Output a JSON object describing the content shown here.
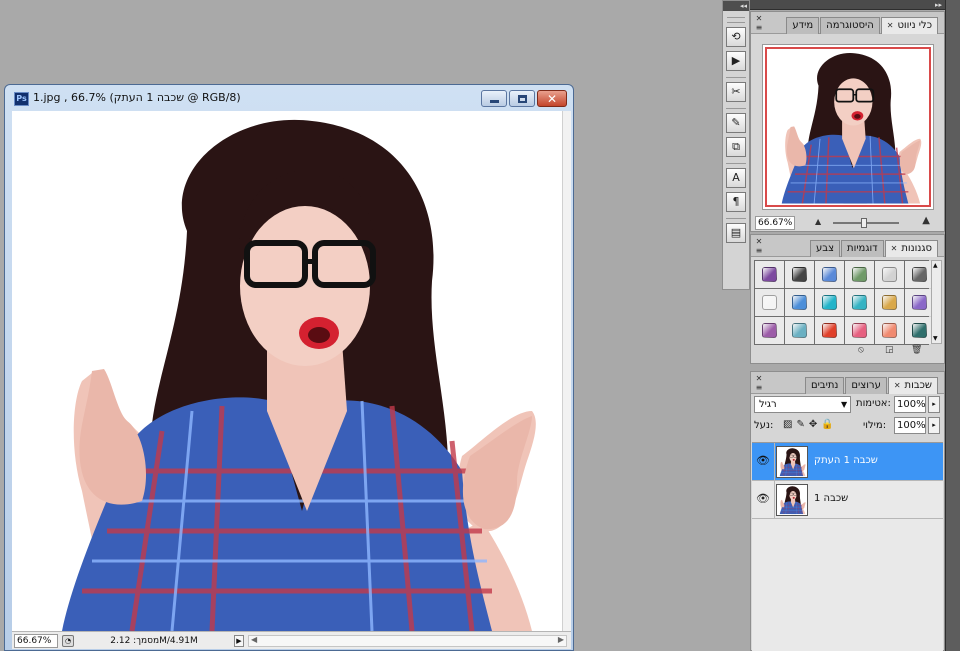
{
  "document": {
    "title": "1.jpg , שכבה 1 העתק) 66.7% @ RGB/8)",
    "app_badge": "Ps",
    "status": {
      "zoom": "66.67%",
      "size": "מסמך: 2.12M/4.91M"
    }
  },
  "tools": {
    "items": [
      {
        "icon": "history-brush-icon",
        "glyph": "⟲"
      },
      {
        "icon": "play-action-icon",
        "glyph": "▶"
      },
      {
        "icon": "tool-presets-icon",
        "glyph": "✂"
      },
      {
        "icon": "brushes-icon",
        "glyph": "✎"
      },
      {
        "icon": "clone-source-icon",
        "glyph": "⧉"
      },
      {
        "icon": "character-icon",
        "glyph": "A"
      },
      {
        "icon": "paragraph-icon",
        "glyph": "¶"
      },
      {
        "icon": "notes-icon",
        "glyph": "▤"
      }
    ]
  },
  "navigator_panel": {
    "tabs": [
      "כלי ניווט",
      "היסטוגרמה",
      "מידע"
    ],
    "zoom": "66.67%"
  },
  "styles_panel": {
    "tabs": [
      "סגנונות",
      "דוגמיות",
      "צבע"
    ],
    "swatches": [
      "#7d4aa0",
      "#444444",
      "#5b8ad8",
      "#6f9a68",
      "#d2d2d2",
      "#666666",
      "#f4f4f4",
      "#4d8fd9",
      "#22b4c9",
      "#35b3c3",
      "#d9a84a",
      "#8a68c8",
      "#9c5ca8",
      "#6ab0c2",
      "#e0402a",
      "#e66080",
      "#f08a70",
      "#2f6f6c"
    ]
  },
  "layers_panel": {
    "tabs": [
      "שכבות",
      "ערוצים",
      "נתיבים"
    ],
    "blend_mode": "רגיל",
    "opacity_label": "אטימות:",
    "opacity": "100%",
    "lock_label": "נעל:",
    "fill_label": "מילוי:",
    "fill": "100%",
    "layers": [
      {
        "name": "שכבה 1 העתק",
        "selected": true
      },
      {
        "name": "שכבה 1",
        "selected": false
      }
    ]
  },
  "colors": {
    "selection": "#3d95f5",
    "nav_frame": "#d94a4a"
  }
}
